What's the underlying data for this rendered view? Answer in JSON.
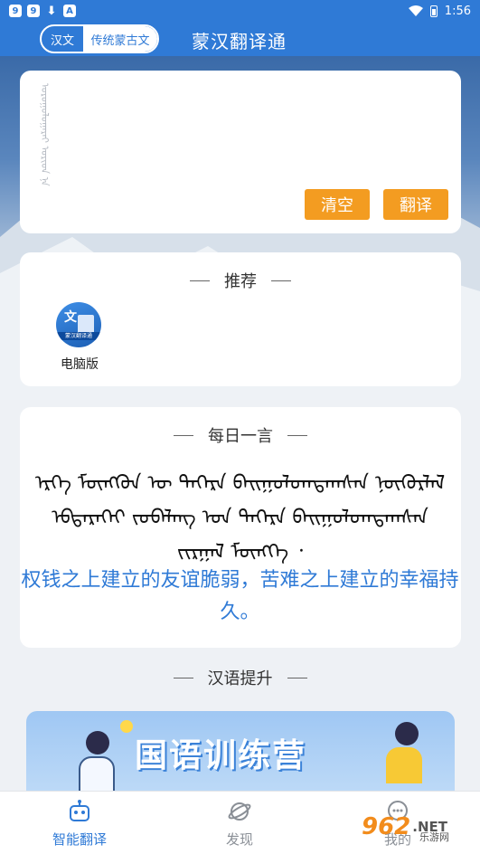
{
  "status_bar": {
    "time": "1:56",
    "icons": [
      "9",
      "9",
      "download",
      "A"
    ]
  },
  "header": {
    "lang_a": "汉文",
    "lang_b": "传统蒙古文",
    "title": "蒙汉翻译通"
  },
  "input": {
    "placeholder": "ᠣᠷᠣᠭᠤᠯᠤᠭᠠᠷᠠᠢ ᠤᠷᠢᠳ ᠨᠡ"
  },
  "buttons": {
    "clear": "清空",
    "translate": "翻译"
  },
  "recommend": {
    "title": "推荐",
    "items": [
      {
        "label": "电脑版",
        "icon_text": "文",
        "icon_caption": "蒙汉翻译通"
      }
    ]
  },
  "daily": {
    "title": "每日一言",
    "mongolian_lines": [
      "ᠡᠷᠬᠡ ᠮᠥᠩᠭᠦᠨ ᠦ ᠳᠡᠭᠡᠷᠡ ᠪᠠᠢᠭᠤᠯᠤᠭᠳᠠᠭᠰᠠᠨ ᠨᠥᠬᠦᠷᠯᠡᠯ",
      "ᠡᠪᠳᠡᠷᠡᠬᠡᠢ ᠵᠣᠪᠠᠯᠠᠩ ᠤᠨ ᠳᠡᠭᠡᠷᠡ ᠪᠠᠢᠭᠤᠯᠤᠭᠳᠠᠭᠰᠠᠨ",
      "ᠵᠢᠷᠭᠠᠯ ᠮᠥᠩᠬᠡ ᠂"
    ],
    "chinese": "权钱之上建立的友谊脆弱，苦难之上建立的幸福持久。"
  },
  "improve": {
    "title": "汉语提升",
    "banner_text": "国语训练营"
  },
  "nav": [
    {
      "label": "智能翻译",
      "icon": "robot-icon"
    },
    {
      "label": "发现",
      "icon": "planet-icon"
    },
    {
      "label": "我的",
      "icon": "chat-icon"
    }
  ],
  "watermark": {
    "logo": "962",
    "net": ".NET",
    "sub": "乐游网"
  },
  "colors": {
    "primary": "#2f7ad6",
    "accent": "#f39c21"
  }
}
